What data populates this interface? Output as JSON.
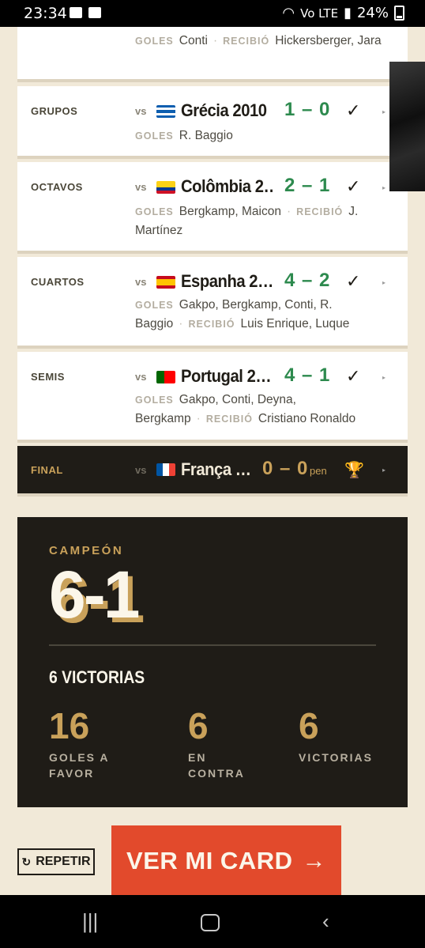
{
  "status_bar": {
    "time": "23:34",
    "battery": "24%",
    "network": "Vo LTE"
  },
  "matches": [
    {
      "round": "",
      "goals_label": "GOLES",
      "goals": "Conti",
      "conceded_label": "RECIBIÓ",
      "conceded": "Hickersberger, Jara"
    },
    {
      "round": "GRUPOS",
      "vs": "vs",
      "opponent": "Grécia 2010",
      "score": "1 – 0",
      "result": "✓",
      "goals_label": "GOLES",
      "goals": "R. Baggio"
    },
    {
      "round": "OCTAVOS",
      "vs": "vs",
      "opponent": "Colômbia 2…",
      "score": "2 – 1",
      "result": "✓",
      "goals_label": "GOLES",
      "goals": "Bergkamp, Maicon",
      "conceded_label": "RECIBIÓ",
      "conceded": "J. Martínez"
    },
    {
      "round": "CUARTOS",
      "vs": "vs",
      "opponent": "Espanha 2…",
      "score": "4 – 2",
      "result": "✓",
      "goals_label": "GOLES",
      "goals": "Gakpo, Bergkamp, Conti, R. Baggio",
      "conceded_label": "RECIBIÓ",
      "conceded": "Luis Enrique, Luque"
    },
    {
      "round": "SEMIS",
      "vs": "vs",
      "opponent": "Portugal 2…",
      "score": "4 – 1",
      "result": "✓",
      "goals_label": "GOLES",
      "goals": "Gakpo, Conti, Deyna, Bergkamp",
      "conceded_label": "RECIBIÓ",
      "conceded": "Cristiano Ronaldo"
    },
    {
      "round": "FINAL",
      "vs": "vs",
      "opponent": "França …",
      "score": "0 – 0",
      "pen": "pen",
      "result": "🏆"
    }
  ],
  "champion": {
    "eyebrow": "CAMPEÓN",
    "record": "6-1",
    "wins_title": "6 VICTORIAS",
    "stats": [
      {
        "value": "16",
        "label": "GOLES A FAVOR"
      },
      {
        "value": "6",
        "label": "EN CONTRA"
      },
      {
        "value": "6",
        "label": "VICTORIAS"
      }
    ]
  },
  "actions": {
    "repeat": "REPETIR",
    "view_card": "VER MI CARD",
    "view_card_arrow": "→"
  }
}
